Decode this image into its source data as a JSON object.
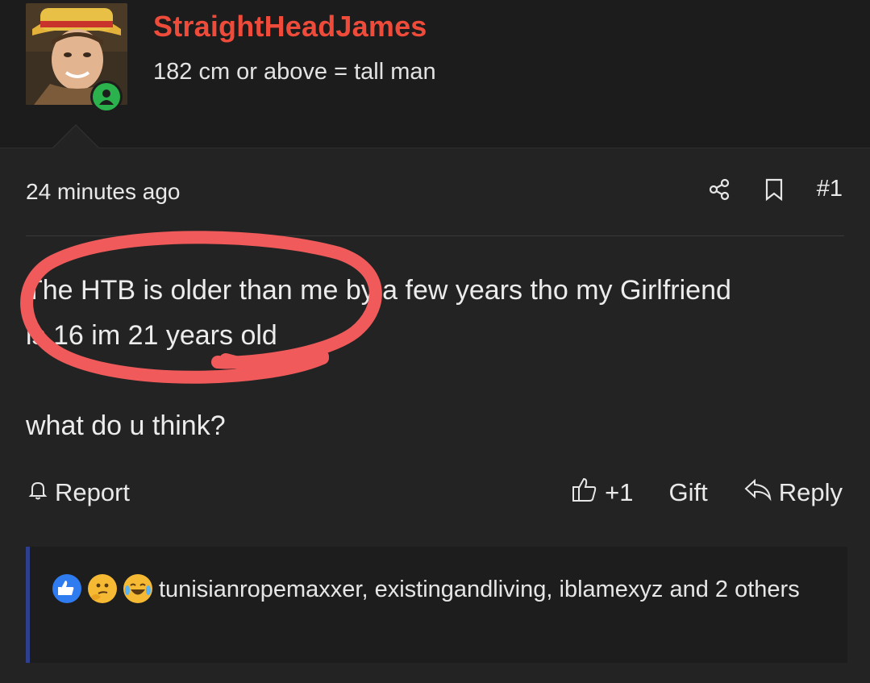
{
  "user": {
    "name": "StraightHeadJames",
    "title": "182 cm or above = tall man",
    "status": "online"
  },
  "post": {
    "timestamp": "24 minutes ago",
    "number": "#1",
    "body_line1": "The HTB is older than me by a few years tho my Girlfriend",
    "body_line2": "is 16 im 21 years old",
    "body_line3": "what do u think?"
  },
  "actions": {
    "report": "Report",
    "like_count": "+1",
    "gift": "Gift",
    "reply": "Reply"
  },
  "reactions": {
    "emojis": [
      "like",
      "thinking",
      "laughing-crying"
    ],
    "text": "tunisianropemaxxer, existingandliving, iblamexyz and 2 others"
  },
  "colors": {
    "username": "#ee4b3a",
    "online": "#2bb24c",
    "annotation": "#f05a5a",
    "reaction_border": "#2e3f8e"
  },
  "icons": [
    "share-icon",
    "bookmark-icon",
    "bell-icon",
    "thumbs-up-icon",
    "reply-icon",
    "user-icon"
  ]
}
